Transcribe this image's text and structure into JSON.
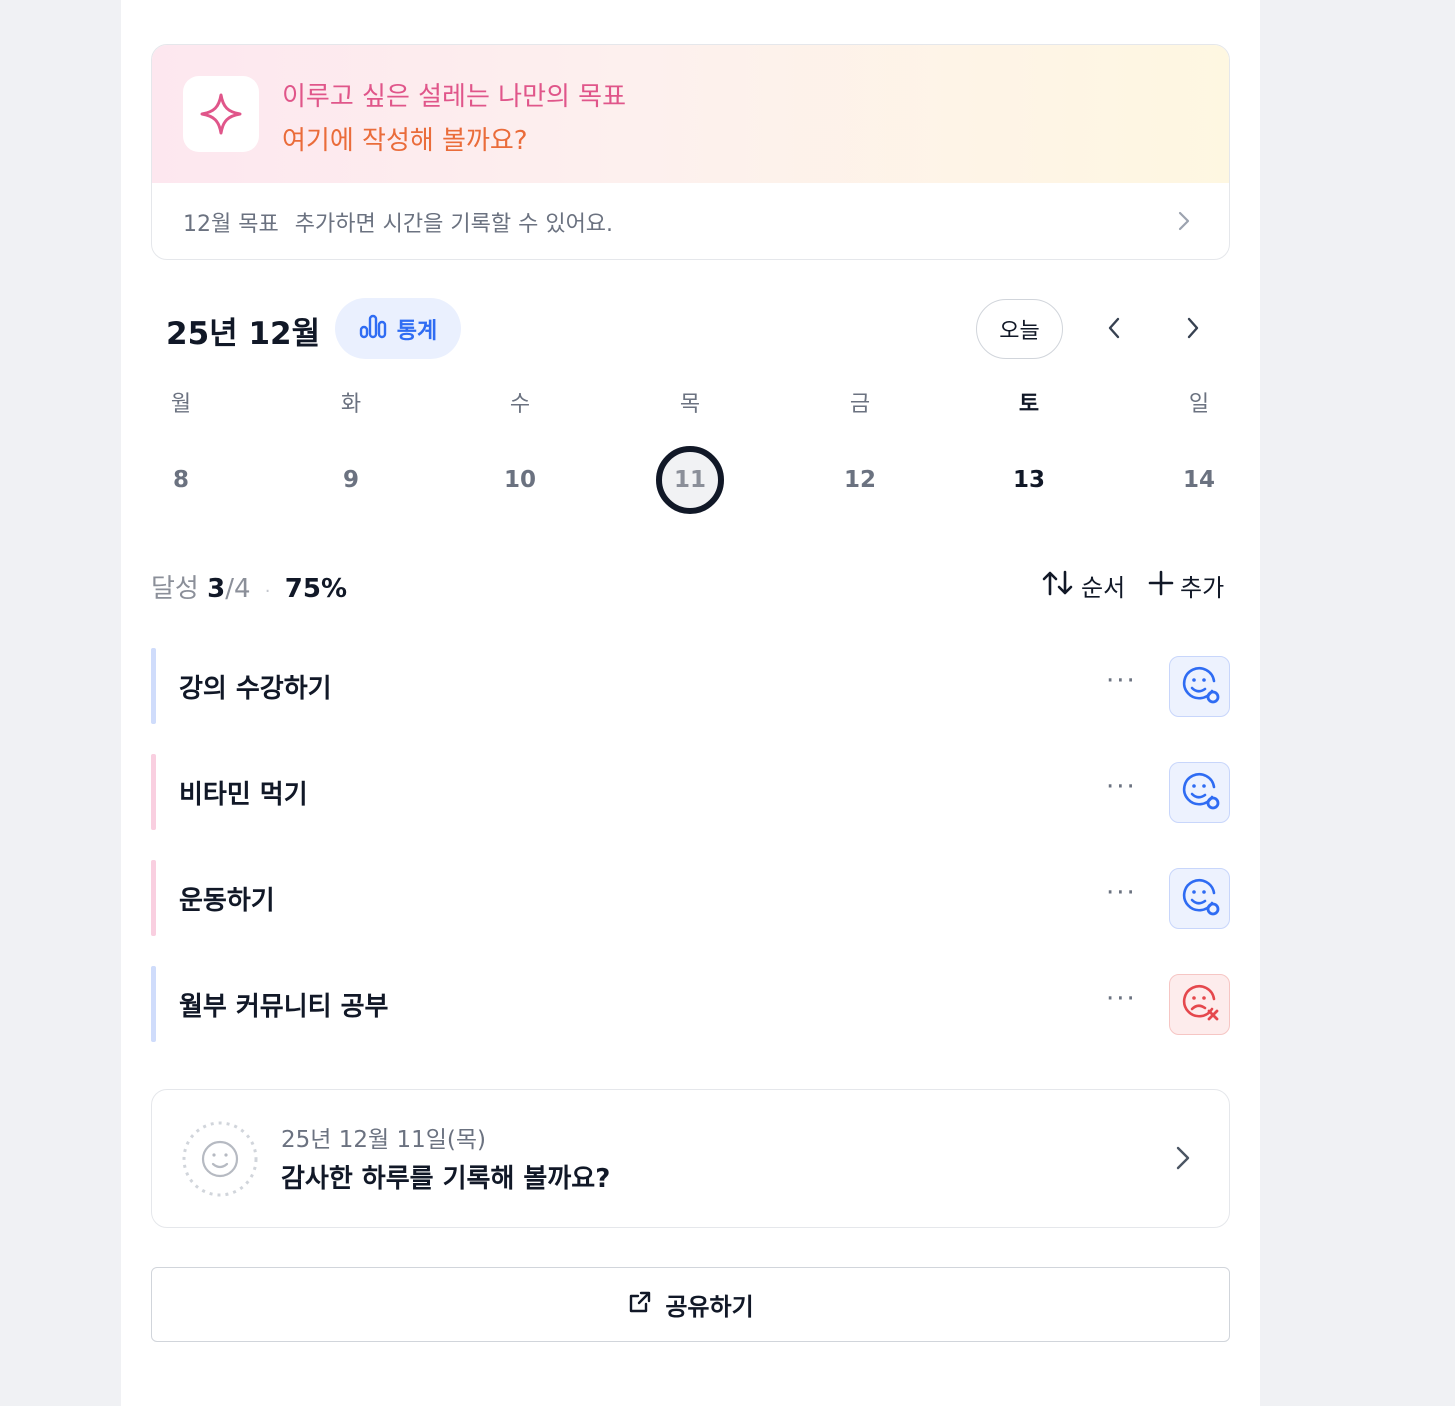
{
  "goal_banner": {
    "line1": "이루고 싶은 설레는 나만의 목표",
    "line2": "여기에 작성해 볼까요?",
    "footer_month_goal": "12월 목표",
    "footer_text": "추가하면 시간을 기록할 수 있어요."
  },
  "header": {
    "month_title": "25년 12월",
    "stats_label": "통계",
    "today_label": "오늘"
  },
  "week": [
    {
      "name": "월",
      "day": "8"
    },
    {
      "name": "화",
      "day": "9"
    },
    {
      "name": "수",
      "day": "10"
    },
    {
      "name": "목",
      "day": "11"
    },
    {
      "name": "금",
      "day": "12"
    },
    {
      "name": "토",
      "day": "13"
    },
    {
      "name": "일",
      "day": "14"
    }
  ],
  "progress": {
    "label": "달성",
    "done": "3",
    "total": "/4",
    "percent": "75%"
  },
  "actions": {
    "sort_label": "순서",
    "add_label": "추가"
  },
  "tasks": [
    {
      "title": "강의 수강하기",
      "status": "done",
      "bar_color": "#cfdcfb"
    },
    {
      "title": "비타민 먹기",
      "status": "done",
      "bar_color": "#f9cfe0"
    },
    {
      "title": "운동하기",
      "status": "done",
      "bar_color": "#f9cfe0"
    },
    {
      "title": "월부 커뮤니티 공부",
      "status": "failed",
      "bar_color": "#cfdcfb"
    }
  ],
  "more_label": "···",
  "gratitude": {
    "date": "25년 12월 11일(목)",
    "prompt": "감사한 하루를 기록해 볼까요?"
  },
  "share_label": "공유하기",
  "colors": {
    "accent_blue": "#2f6cf3",
    "fail_red": "#e5484d",
    "goal_pink": "#e0568a",
    "goal_orange": "#ea6c3a"
  }
}
